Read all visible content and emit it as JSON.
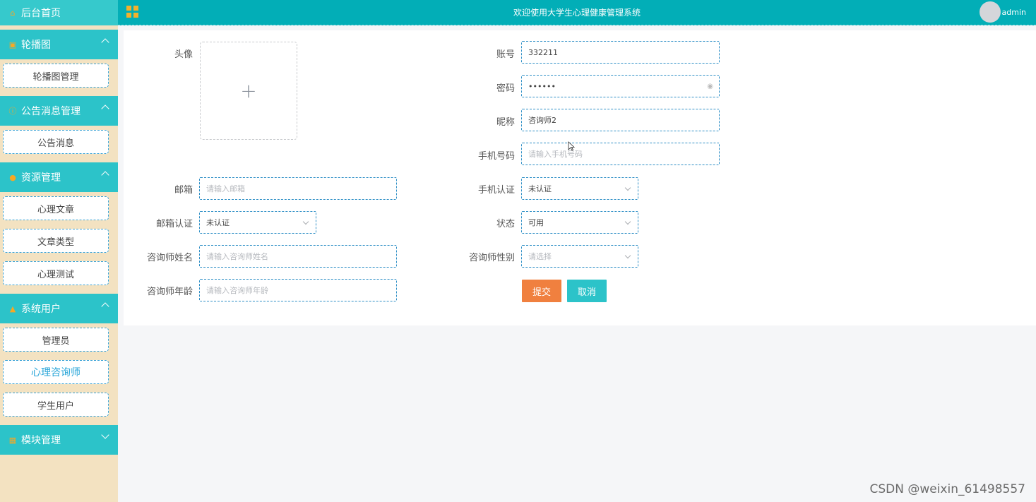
{
  "sidebar": {
    "home": "后台首页",
    "groups": [
      {
        "label": "轮播图",
        "items": [
          "轮播图管理"
        ]
      },
      {
        "label": "公告消息管理",
        "items": [
          "公告消息"
        ]
      },
      {
        "label": "资源管理",
        "items": [
          "心理文章",
          "文章类型",
          "心理测试"
        ]
      },
      {
        "label": "系统用户",
        "items": [
          "管理员",
          "心理咨询师",
          "学生用户"
        ]
      },
      {
        "label": "模块管理",
        "items": []
      }
    ]
  },
  "topbar": {
    "title": "欢迎使用大学生心理健康管理系统",
    "user": "admin"
  },
  "form": {
    "avatar_label": "头像",
    "uploader_plus": "+",
    "account_label": "账号",
    "account_value": "332211",
    "password_label": "密码",
    "password_value": "••••••",
    "nickname_label": "昵称",
    "nickname_value": "咨询师2",
    "phone_label": "手机号码",
    "phone_placeholder": "请输入手机号码",
    "email_label": "邮箱",
    "email_placeholder": "请输入邮箱",
    "phone_verify_label": "手机认证",
    "phone_verify_value": "未认证",
    "email_verify_label": "邮箱认证",
    "email_verify_value": "未认证",
    "status_label": "状态",
    "status_value": "可用",
    "name_label": "咨询师姓名",
    "name_placeholder": "请输入咨询师姓名",
    "gender_label": "咨询师性别",
    "gender_placeholder": "请选择",
    "age_label": "咨询师年龄",
    "age_placeholder": "请输入咨询师年龄",
    "submit": "提交",
    "cancel": "取消"
  },
  "watermark": "CSDN @weixin_61498557",
  "colors": {
    "sidebar_bg": "#f3e2c1",
    "nav_accent": "#2cc3c9",
    "topbar": "#02aeb7",
    "submit": "#f0803f",
    "cancel": "#2cc3c9"
  }
}
